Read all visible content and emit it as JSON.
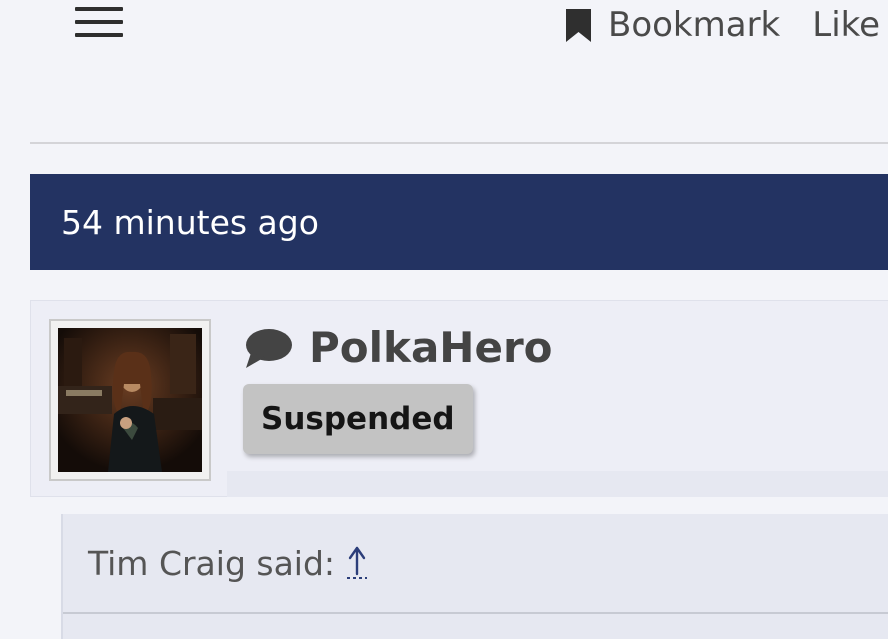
{
  "toolbar": {
    "menu_icon": "hamburger-menu-icon",
    "bookmark_icon": "bookmark-icon",
    "bookmark_label": "Bookmark",
    "like_label": "Like"
  },
  "post": {
    "time": "54 minutes ago",
    "author": {
      "name": "PolkaHero",
      "icon": "chat-bubble-icon",
      "badge": "Suspended"
    },
    "quote": {
      "attribution": "Tim Craig said:",
      "link_icon": "up-arrow-icon"
    }
  },
  "colors": {
    "header_bar": "#233362",
    "badge_bg": "#c3c3c3",
    "page_bg": "#f3f4f9",
    "link": "#233362"
  }
}
